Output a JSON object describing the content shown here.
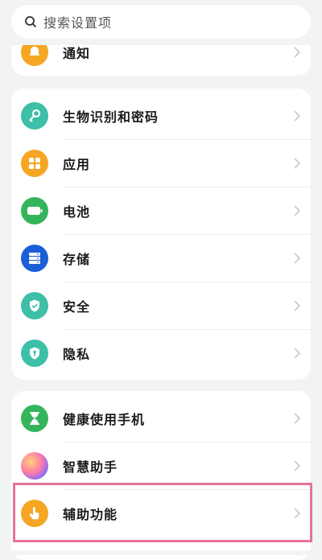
{
  "search": {
    "placeholder": "搜索设置项",
    "icon": "search-icon"
  },
  "card1": {
    "items": [
      {
        "label": "通知",
        "icon": "bell-icon",
        "color": "#f5a623"
      }
    ]
  },
  "card2": {
    "items": [
      {
        "label": "生物识别和密码",
        "icon": "key-icon",
        "color": "#3dbfa8"
      },
      {
        "label": "应用",
        "icon": "apps-grid-icon",
        "color": "#f5a623"
      },
      {
        "label": "电池",
        "icon": "battery-icon",
        "color": "#35b55b"
      },
      {
        "label": "存储",
        "icon": "storage-icon",
        "color": "#1a5fd6"
      },
      {
        "label": "安全",
        "icon": "shield-icon",
        "color": "#3dbfa8"
      },
      {
        "label": "隐私",
        "icon": "privacy-icon",
        "color": "#3dbfa8"
      }
    ]
  },
  "card3": {
    "items": [
      {
        "label": "健康使用手机",
        "icon": "hourglass-icon",
        "color": "#35b55b"
      },
      {
        "label": "智慧助手",
        "icon": "assistant-icon",
        "color": "#b46cf0"
      },
      {
        "label": "辅助功能",
        "icon": "hand-pointer-icon",
        "color": "#f5a623"
      }
    ]
  }
}
